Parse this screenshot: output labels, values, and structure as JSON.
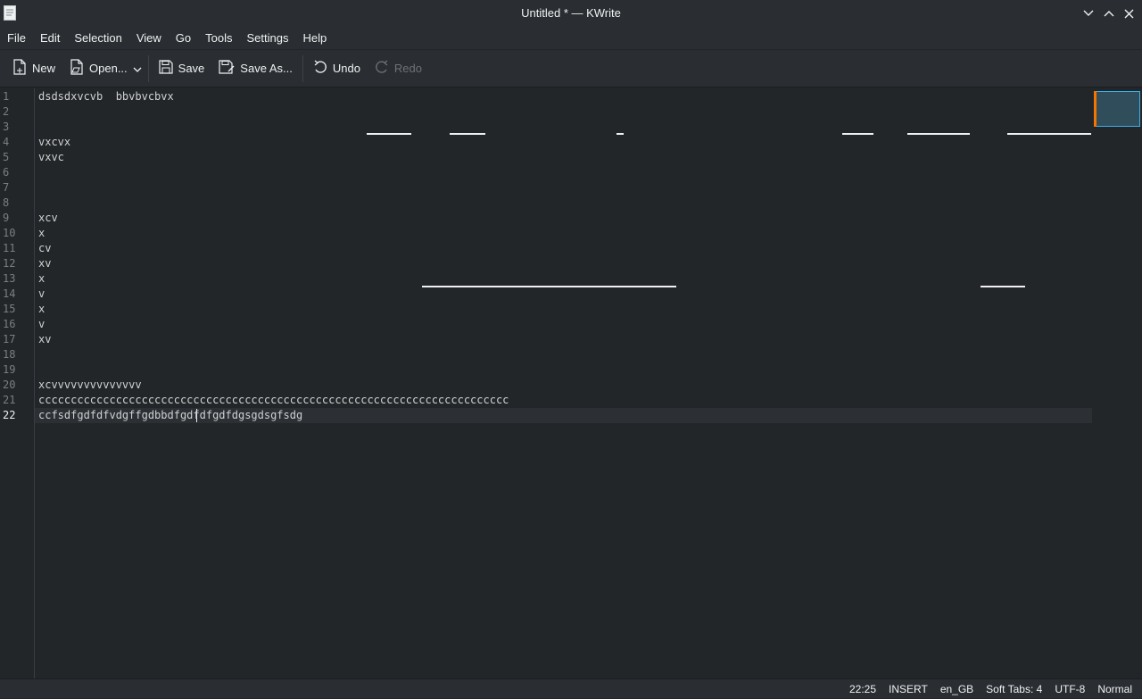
{
  "window": {
    "title": "Untitled * — KWrite",
    "controls": [
      "minimize-icon",
      "maximize-icon",
      "close-icon"
    ]
  },
  "menu": [
    "File",
    "Edit",
    "Selection",
    "View",
    "Go",
    "Tools",
    "Settings",
    "Help"
  ],
  "toolbar": {
    "new_label": "New",
    "open_label": "Open...",
    "save_label": "Save",
    "save_as_label": "Save As...",
    "undo_label": "Undo",
    "redo_label": "Redo"
  },
  "editor": {
    "lines": [
      "dsdsdxvcvb  bbvbvcbvx",
      "",
      "",
      "vxcvx",
      "vxvc",
      "",
      "",
      "",
      "xcv",
      "x",
      "cv",
      "xv",
      "x",
      "v",
      "x",
      "v",
      "xv",
      "",
      "",
      "xcvvvvvvvvvvvvvv",
      "ccccccccccccccccccccccccccccccccccccccccccccccccccccccccccccccccccccccccc",
      "ccfsdfgdfdfvdgffgdbbdfgdfdfgdfdgsgdsgfsdg"
    ],
    "line_numbers": [
      "1",
      "2",
      "3",
      "4",
      "5",
      "6",
      "7",
      "8",
      "9",
      "10",
      "11",
      "12",
      "13",
      "14",
      "15",
      "16",
      "17",
      "18",
      "19",
      "20",
      "21",
      "22"
    ],
    "current_line": 22
  },
  "status": {
    "cursor_position": "22:25",
    "mode": "INSERT",
    "language": "en_GB",
    "indentation": "Soft Tabs: 4",
    "encoding": "UTF-8",
    "input_mode": "Normal"
  },
  "colors": {
    "background": "#232629",
    "chrome": "#2a2e32",
    "accent": "#3daee9",
    "minimap_marker": "#f67400"
  }
}
